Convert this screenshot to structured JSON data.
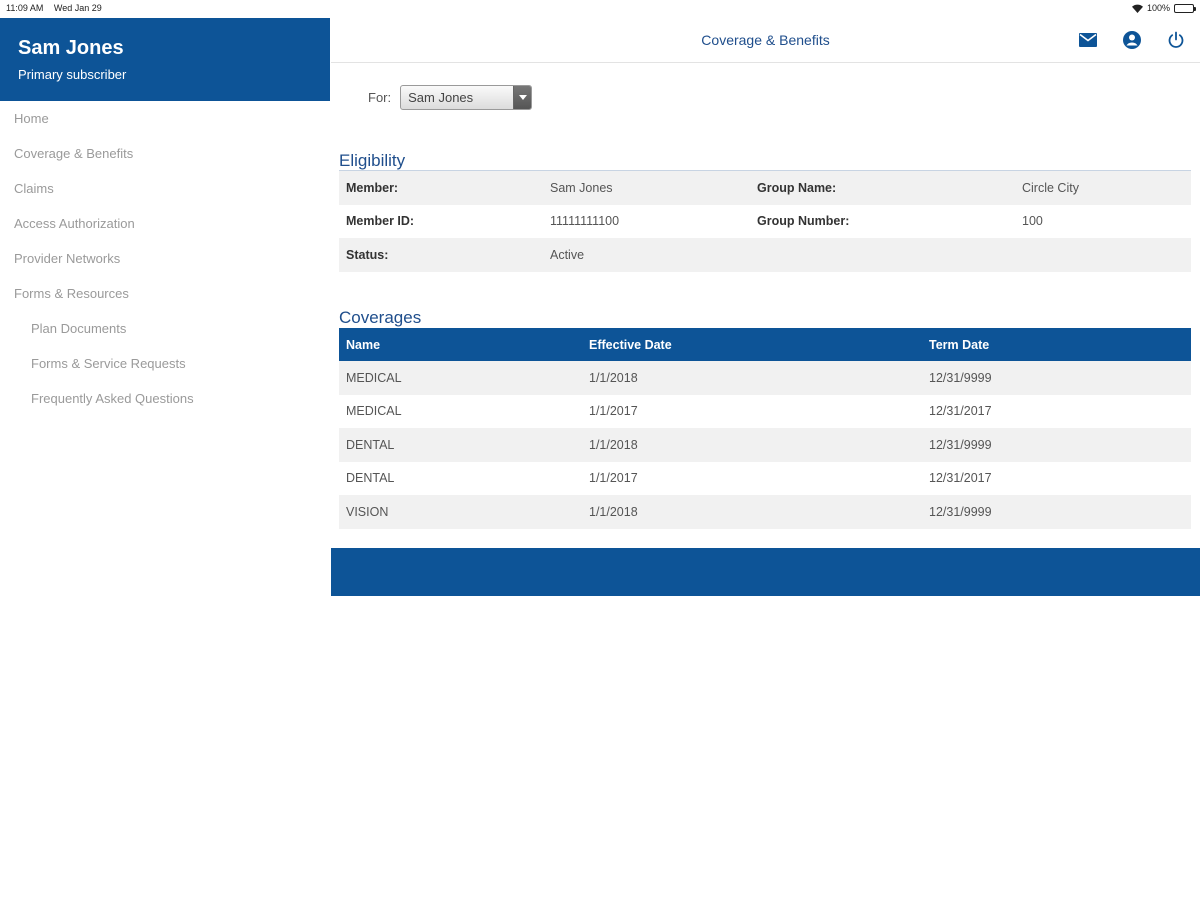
{
  "status_bar": {
    "time": "11:09 AM",
    "date": "Wed Jan 29",
    "battery": "100%"
  },
  "user": {
    "name": "Sam Jones",
    "role": "Primary subscriber"
  },
  "nav": {
    "items": [
      {
        "label": "Home"
      },
      {
        "label": "Coverage & Benefits"
      },
      {
        "label": "Claims"
      },
      {
        "label": "Access Authorization"
      },
      {
        "label": "Provider Networks"
      },
      {
        "label": "Forms & Resources"
      },
      {
        "label": "Plan Documents"
      },
      {
        "label": "Forms & Service Requests"
      },
      {
        "label": "Frequently Asked Questions"
      }
    ]
  },
  "header": {
    "title": "Coverage & Benefits",
    "icons": [
      "mail-icon",
      "account-icon",
      "power-icon"
    ]
  },
  "for_selector": {
    "label": "For:",
    "value": "Sam Jones"
  },
  "eligibility": {
    "title": "Eligibility",
    "rows": [
      {
        "label1": "Member:",
        "value1": "Sam Jones",
        "label2": "Group Name:",
        "value2": "Circle City"
      },
      {
        "label1": "Member ID:",
        "value1": "11111111100",
        "label2": "Group Number:",
        "value2": "100"
      },
      {
        "label1": "Status:",
        "value1": "Active",
        "label2": "",
        "value2": ""
      }
    ]
  },
  "coverages": {
    "title": "Coverages",
    "headers": [
      "Name",
      "Effective Date",
      "Term Date"
    ],
    "rows": [
      [
        "MEDICAL",
        "1/1/2018",
        "12/31/9999"
      ],
      [
        "MEDICAL",
        "1/1/2017",
        "12/31/2017"
      ],
      [
        "DENTAL",
        "1/1/2018",
        "12/31/9999"
      ],
      [
        "DENTAL",
        "1/1/2017",
        "12/31/2017"
      ],
      [
        "VISION",
        "1/1/2018",
        "12/31/9999"
      ]
    ]
  },
  "colors": {
    "brand": "#0d5497",
    "title": "#1f4e8c",
    "nav_text": "#9a9a9a"
  }
}
